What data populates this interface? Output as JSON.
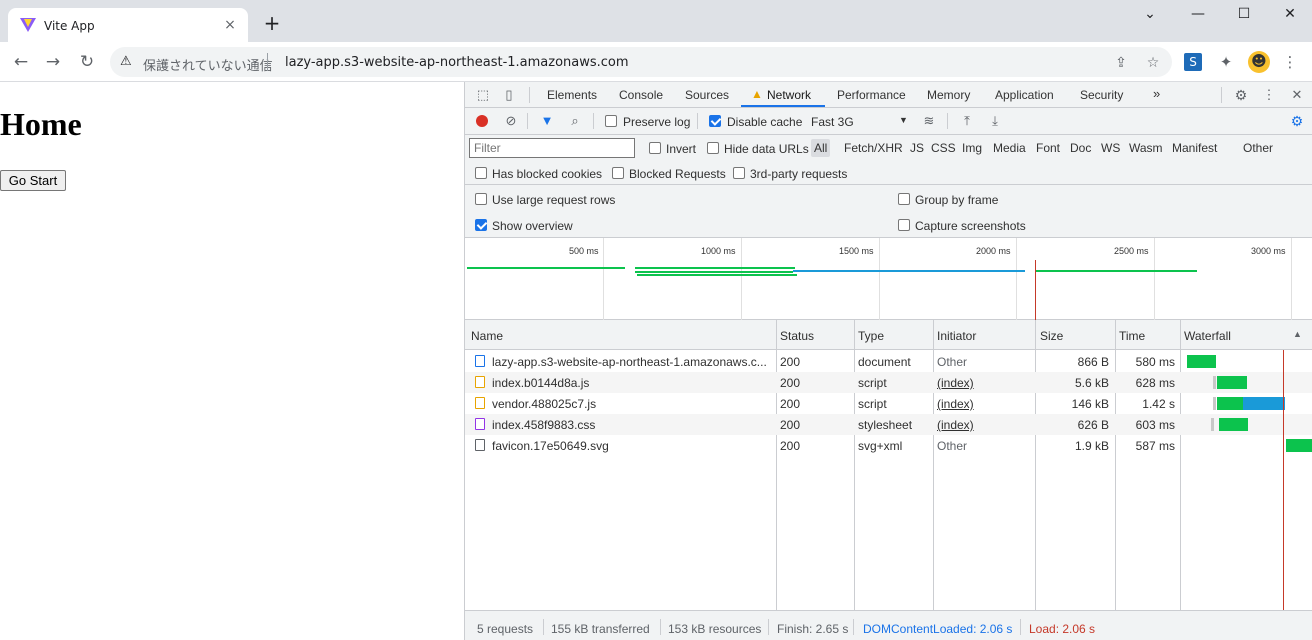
{
  "browser": {
    "tab_title": "Vite App",
    "tab_close": "×",
    "new_tab": "+",
    "window_buttons": [
      "⌄",
      "—",
      "☐",
      "✕"
    ],
    "security_warning": "保護されていない通信",
    "url": "lazy-app.s3-website-ap-northeast-1.amazonaws.com"
  },
  "page": {
    "heading": "Home",
    "button": "Go Start"
  },
  "devtools": {
    "tabs": [
      "Elements",
      "Console",
      "Sources",
      "Network",
      "Performance",
      "Memory",
      "Application",
      "Security"
    ],
    "more_tabs": "»",
    "active_tab": "Network",
    "toolbar": {
      "preserve_log": "Preserve log",
      "disable_cache": "Disable cache",
      "throttle": "Fast 3G"
    },
    "filter": {
      "placeholder": "Filter",
      "invert": "Invert",
      "hide_data_urls": "Hide data URLs",
      "types": [
        "All",
        "Fetch/XHR",
        "JS",
        "CSS",
        "Img",
        "Media",
        "Font",
        "Doc",
        "WS",
        "Wasm",
        "Manifest",
        "Other"
      ],
      "has_blocked_cookies": "Has blocked cookies",
      "blocked_requests": "Blocked Requests",
      "third_party": "3rd-party requests"
    },
    "settings": {
      "large_rows": "Use large request rows",
      "group_by_frame": "Group by frame",
      "show_overview": "Show overview",
      "capture_screenshots": "Capture screenshots"
    },
    "overview": {
      "ticks": [
        "500 ms",
        "1000 ms",
        "1500 ms",
        "2000 ms",
        "2500 ms",
        "3000 ms"
      ]
    },
    "columns": [
      "Name",
      "Status",
      "Type",
      "Initiator",
      "Size",
      "Time",
      "Waterfall"
    ],
    "requests": [
      {
        "name": "lazy-app.s3-website-ap-northeast-1.amazonaws.c...",
        "status": "200",
        "type": "document",
        "initiator": "Other",
        "size": "866 B",
        "time": "580 ms",
        "kind": "doc"
      },
      {
        "name": "index.b0144d8a.js",
        "status": "200",
        "type": "script",
        "initiator": "(index)",
        "size": "5.6 kB",
        "time": "628 ms",
        "kind": "js"
      },
      {
        "name": "vendor.488025c7.js",
        "status": "200",
        "type": "script",
        "initiator": "(index)",
        "size": "146 kB",
        "time": "1.42 s",
        "kind": "js"
      },
      {
        "name": "index.458f9883.css",
        "status": "200",
        "type": "stylesheet",
        "initiator": "(index)",
        "size": "626 B",
        "time": "603 ms",
        "kind": "css"
      },
      {
        "name": "favicon.17e50649.svg",
        "status": "200",
        "type": "svg+xml",
        "initiator": "Other",
        "size": "1.9 kB",
        "time": "587 ms",
        "kind": "other"
      }
    ],
    "status_bar": {
      "requests": "5 requests",
      "transferred": "155 kB transferred",
      "resources": "153 kB resources",
      "finish": "Finish: 2.65 s",
      "dom_content_loaded": "DOMContentLoaded: 2.06 s",
      "load": "Load: 2.06 s"
    }
  },
  "colors": {
    "accent": "#1a73e8",
    "record": "#d93025",
    "waterfall_green": "#0cc34d",
    "waterfall_blue": "#1a9ad8",
    "load_line": "#c53929"
  }
}
